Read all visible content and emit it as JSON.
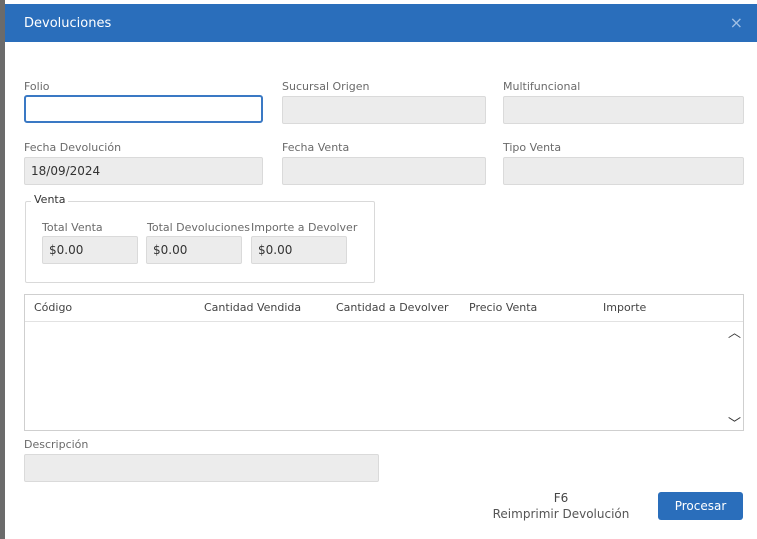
{
  "dialog": {
    "title": "Devoluciones",
    "close_glyph": "×"
  },
  "fields": {
    "folio": {
      "label": "Folio",
      "value": ""
    },
    "sucursal_origen": {
      "label": "Sucursal Origen",
      "value": ""
    },
    "multifuncional": {
      "label": "Multifuncional",
      "value": ""
    },
    "fecha_devolucion": {
      "label": "Fecha Devolución",
      "value": "18/09/2024"
    },
    "fecha_venta": {
      "label": "Fecha Venta",
      "value": ""
    },
    "tipo_venta": {
      "label": "Tipo Venta",
      "value": ""
    }
  },
  "venta": {
    "title": "Venta",
    "total_venta": {
      "label": "Total Venta",
      "value": "$0.00"
    },
    "total_devoluciones": {
      "label": "Total Devoluciones",
      "value": "$0.00"
    },
    "importe_devolver": {
      "label": "Importe a Devolver",
      "value": "$0.00"
    }
  },
  "grid": {
    "columns": [
      "Código",
      "Cantidad Vendida",
      "Cantidad a Devolver",
      "Precio Venta",
      "Importe"
    ],
    "rows": [],
    "scroll_up_glyph": "︿",
    "scroll_down_glyph": "﹀"
  },
  "descripcion": {
    "label": "Descripción",
    "value": ""
  },
  "footer": {
    "shortcut_key": "F6",
    "reprint_label": "Reimprimir Devolución",
    "process_label": "Procesar"
  },
  "colors": {
    "accent": "#2a6ebb",
    "field_bg": "#ececec",
    "focus_border": "#3a79c4"
  }
}
